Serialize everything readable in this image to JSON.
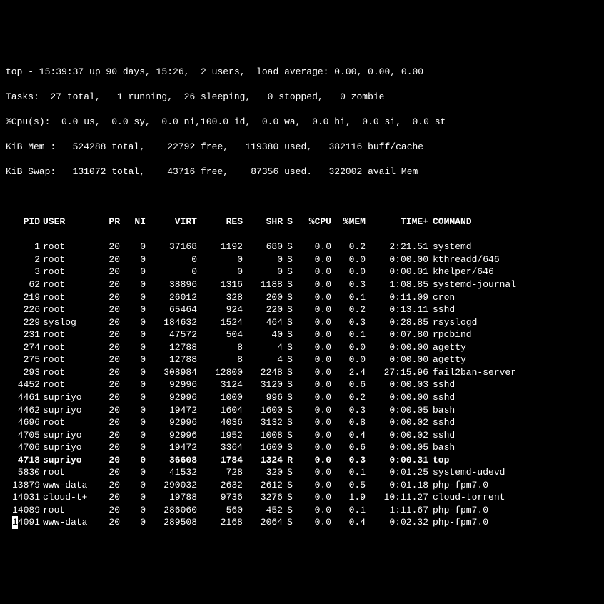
{
  "summary": {
    "line1": "top - 15:39:37 up 90 days, 15:26,  2 users,  load average: 0.00, 0.00, 0.00",
    "line2": "Tasks:  27 total,   1 running,  26 sleeping,   0 stopped,   0 zombie",
    "line3": "%Cpu(s):  0.0 us,  0.0 sy,  0.0 ni,100.0 id,  0.0 wa,  0.0 hi,  0.0 si,  0.0 st",
    "line4": "KiB Mem :   524288 total,    22792 free,   119380 used,   382116 buff/cache",
    "line5": "KiB Swap:   131072 total,    43716 free,    87356 used.   322002 avail Mem"
  },
  "columns": {
    "pid": "PID",
    "user": "USER",
    "pr": "PR",
    "ni": "NI",
    "virt": "VIRT",
    "res": "RES",
    "shr": "SHR",
    "s": "S",
    "cpu": "%CPU",
    "mem": "%MEM",
    "time": "TIME+",
    "cmd": "COMMAND"
  },
  "processes": [
    {
      "pid": "1",
      "user": "root",
      "pr": "20",
      "ni": "0",
      "virt": "37168",
      "res": "1192",
      "shr": "680",
      "s": "S",
      "cpu": "0.0",
      "mem": "0.2",
      "time": "2:21.51",
      "cmd": "systemd"
    },
    {
      "pid": "2",
      "user": "root",
      "pr": "20",
      "ni": "0",
      "virt": "0",
      "res": "0",
      "shr": "0",
      "s": "S",
      "cpu": "0.0",
      "mem": "0.0",
      "time": "0:00.00",
      "cmd": "kthreadd/646"
    },
    {
      "pid": "3",
      "user": "root",
      "pr": "20",
      "ni": "0",
      "virt": "0",
      "res": "0",
      "shr": "0",
      "s": "S",
      "cpu": "0.0",
      "mem": "0.0",
      "time": "0:00.01",
      "cmd": "khelper/646"
    },
    {
      "pid": "62",
      "user": "root",
      "pr": "20",
      "ni": "0",
      "virt": "38896",
      "res": "1316",
      "shr": "1188",
      "s": "S",
      "cpu": "0.0",
      "mem": "0.3",
      "time": "1:08.85",
      "cmd": "systemd-journal"
    },
    {
      "pid": "219",
      "user": "root",
      "pr": "20",
      "ni": "0",
      "virt": "26012",
      "res": "328",
      "shr": "200",
      "s": "S",
      "cpu": "0.0",
      "mem": "0.1",
      "time": "0:11.09",
      "cmd": "cron"
    },
    {
      "pid": "226",
      "user": "root",
      "pr": "20",
      "ni": "0",
      "virt": "65464",
      "res": "924",
      "shr": "220",
      "s": "S",
      "cpu": "0.0",
      "mem": "0.2",
      "time": "0:13.11",
      "cmd": "sshd"
    },
    {
      "pid": "229",
      "user": "syslog",
      "pr": "20",
      "ni": "0",
      "virt": "184632",
      "res": "1524",
      "shr": "464",
      "s": "S",
      "cpu": "0.0",
      "mem": "0.3",
      "time": "0:28.85",
      "cmd": "rsyslogd"
    },
    {
      "pid": "231",
      "user": "root",
      "pr": "20",
      "ni": "0",
      "virt": "47572",
      "res": "504",
      "shr": "40",
      "s": "S",
      "cpu": "0.0",
      "mem": "0.1",
      "time": "0:07.80",
      "cmd": "rpcbind"
    },
    {
      "pid": "274",
      "user": "root",
      "pr": "20",
      "ni": "0",
      "virt": "12788",
      "res": "8",
      "shr": "4",
      "s": "S",
      "cpu": "0.0",
      "mem": "0.0",
      "time": "0:00.00",
      "cmd": "agetty"
    },
    {
      "pid": "275",
      "user": "root",
      "pr": "20",
      "ni": "0",
      "virt": "12788",
      "res": "8",
      "shr": "4",
      "s": "S",
      "cpu": "0.0",
      "mem": "0.0",
      "time": "0:00.00",
      "cmd": "agetty"
    },
    {
      "pid": "293",
      "user": "root",
      "pr": "20",
      "ni": "0",
      "virt": "308984",
      "res": "12800",
      "shr": "2248",
      "s": "S",
      "cpu": "0.0",
      "mem": "2.4",
      "time": "27:15.96",
      "cmd": "fail2ban-server"
    },
    {
      "pid": "4452",
      "user": "root",
      "pr": "20",
      "ni": "0",
      "virt": "92996",
      "res": "3124",
      "shr": "3120",
      "s": "S",
      "cpu": "0.0",
      "mem": "0.6",
      "time": "0:00.03",
      "cmd": "sshd"
    },
    {
      "pid": "4461",
      "user": "supriyo",
      "pr": "20",
      "ni": "0",
      "virt": "92996",
      "res": "1000",
      "shr": "996",
      "s": "S",
      "cpu": "0.0",
      "mem": "0.2",
      "time": "0:00.00",
      "cmd": "sshd"
    },
    {
      "pid": "4462",
      "user": "supriyo",
      "pr": "20",
      "ni": "0",
      "virt": "19472",
      "res": "1604",
      "shr": "1600",
      "s": "S",
      "cpu": "0.0",
      "mem": "0.3",
      "time": "0:00.05",
      "cmd": "bash"
    },
    {
      "pid": "4696",
      "user": "root",
      "pr": "20",
      "ni": "0",
      "virt": "92996",
      "res": "4036",
      "shr": "3132",
      "s": "S",
      "cpu": "0.0",
      "mem": "0.8",
      "time": "0:00.02",
      "cmd": "sshd"
    },
    {
      "pid": "4705",
      "user": "supriyo",
      "pr": "20",
      "ni": "0",
      "virt": "92996",
      "res": "1952",
      "shr": "1008",
      "s": "S",
      "cpu": "0.0",
      "mem": "0.4",
      "time": "0:00.02",
      "cmd": "sshd"
    },
    {
      "pid": "4706",
      "user": "supriyo",
      "pr": "20",
      "ni": "0",
      "virt": "19472",
      "res": "3364",
      "shr": "1600",
      "s": "S",
      "cpu": "0.0",
      "mem": "0.6",
      "time": "0:00.05",
      "cmd": "bash"
    },
    {
      "pid": "4718",
      "user": "supriyo",
      "pr": "20",
      "ni": "0",
      "virt": "36608",
      "res": "1784",
      "shr": "1324",
      "s": "R",
      "cpu": "0.0",
      "mem": "0.3",
      "time": "0:00.31",
      "cmd": "top",
      "active": true
    },
    {
      "pid": "5830",
      "user": "root",
      "pr": "20",
      "ni": "0",
      "virt": "41532",
      "res": "728",
      "shr": "320",
      "s": "S",
      "cpu": "0.0",
      "mem": "0.1",
      "time": "0:01.25",
      "cmd": "systemd-udevd"
    },
    {
      "pid": "13879",
      "user": "www-data",
      "pr": "20",
      "ni": "0",
      "virt": "290032",
      "res": "2632",
      "shr": "2612",
      "s": "S",
      "cpu": "0.0",
      "mem": "0.5",
      "time": "0:01.18",
      "cmd": "php-fpm7.0"
    },
    {
      "pid": "14031",
      "user": "cloud-t+",
      "pr": "20",
      "ni": "0",
      "virt": "19788",
      "res": "9736",
      "shr": "3276",
      "s": "S",
      "cpu": "0.0",
      "mem": "1.9",
      "time": "10:11.27",
      "cmd": "cloud-torrent"
    },
    {
      "pid": "14089",
      "user": "root",
      "pr": "20",
      "ni": "0",
      "virt": "286060",
      "res": "560",
      "shr": "452",
      "s": "S",
      "cpu": "0.0",
      "mem": "0.1",
      "time": "1:11.67",
      "cmd": "php-fpm7.0"
    },
    {
      "pid": "14091",
      "user": "www-data",
      "pr": "20",
      "ni": "0",
      "virt": "289508",
      "res": "2168",
      "shr": "2064",
      "s": "S",
      "cpu": "0.0",
      "mem": "0.4",
      "time": "0:02.32",
      "cmd": "php-fpm7.0",
      "cursor": true
    }
  ]
}
